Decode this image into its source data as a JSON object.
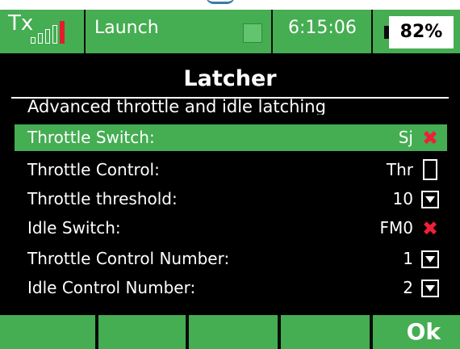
{
  "status": {
    "tx_label": "Tx",
    "model_name": "Launch",
    "time": "6:15:06",
    "battery": "82%"
  },
  "screen": {
    "title": "Latcher",
    "subtitle": "Advanced throttle and idle latching"
  },
  "rows": [
    {
      "label": "Throttle Switch:",
      "value": "Sj",
      "control": "x",
      "selected": true
    },
    {
      "label": "Throttle Control:",
      "value": "Thr",
      "control": "checkbox",
      "selected": false
    },
    {
      "label": "Throttle threshold:",
      "value": "10",
      "control": "dropdown",
      "selected": false
    },
    {
      "label": "Idle Switch:",
      "value": "FM0",
      "control": "x",
      "selected": false
    },
    {
      "label": "Throttle Control Number:",
      "value": "1",
      "control": "dropdown",
      "selected": false
    },
    {
      "label": "Idle Control Number:",
      "value": "2",
      "control": "dropdown",
      "selected": false
    }
  ],
  "footer": {
    "ok_label": "Ok"
  },
  "colors": {
    "accent": "#45ad52",
    "danger": "#ef1f3a",
    "background": "#000000"
  }
}
